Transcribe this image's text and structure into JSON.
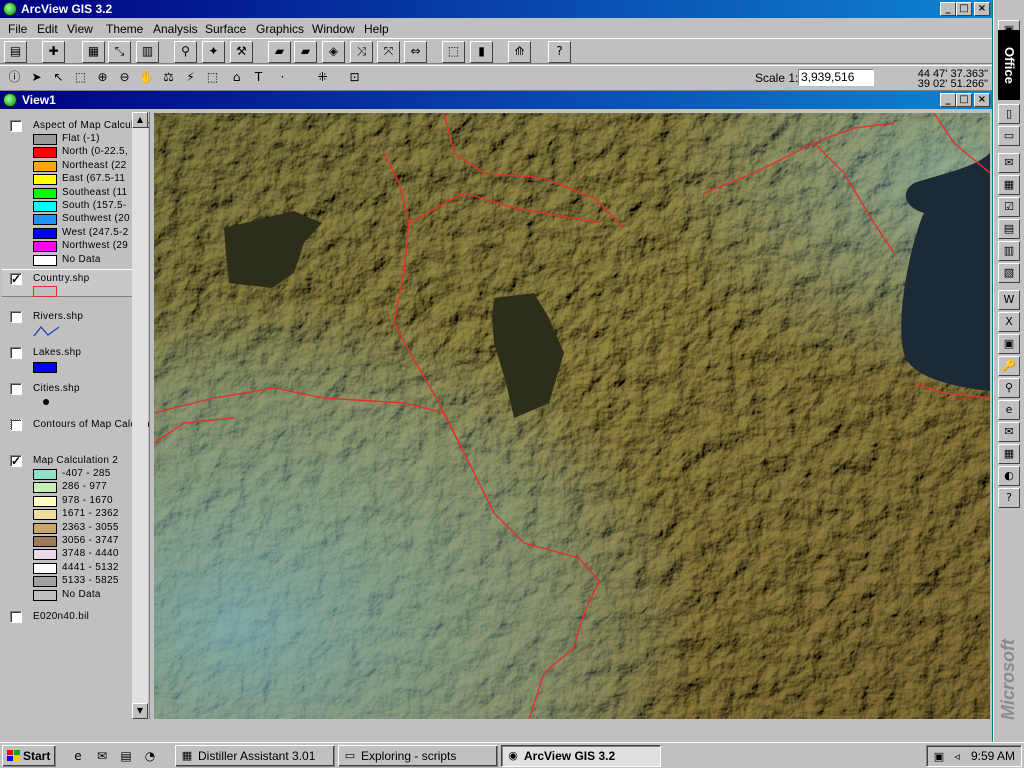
{
  "app": {
    "title": "ArcView GIS 3.2"
  },
  "menu": [
    "File",
    "Edit",
    "View",
    "Theme",
    "Analysis",
    "Surface",
    "Graphics",
    "Window",
    "Help"
  ],
  "toolbar1": {
    "icons": [
      "save-icon",
      "add-theme-icon",
      "theme-properties-icon",
      "edit-legend-icon",
      "open-table-icon",
      "find-icon",
      "locate-address-icon",
      "query-builder-icon",
      "zoom-full-extent-icon",
      "zoom-active-themes-icon",
      "zoom-selected-icon",
      "zoom-in-icon",
      "zoom-out-icon",
      "zoom-previous-icon",
      "select-by-theme-icon",
      "open-theme-table-icon",
      "create-chart-icon",
      "help-icon"
    ]
  },
  "toolbar2": {
    "icons": [
      "identify-icon",
      "pointer-icon",
      "vertex-edit-icon",
      "select-feature-icon",
      "zoom-in-tool-icon",
      "zoom-out-tool-icon",
      "pan-icon",
      "measure-icon",
      "hotlink-icon",
      "area-of-interest-icon",
      "label-icon",
      "text-icon",
      "draw-point-icon",
      "snap-icon",
      "graphics-select-icon"
    ],
    "scale_label": "Scale 1:",
    "scale_value": "3,939,516",
    "coord_x": "44 47' 37.363\"",
    "coord_y": "39 02' 51.266\""
  },
  "view": {
    "title": "View1"
  },
  "toc": {
    "aspect": {
      "name": "Aspect of Map Calculation",
      "checked": false,
      "classes": [
        {
          "label": "Flat (-1)",
          "color": "#9a9a9a"
        },
        {
          "label": "North (0-22.5,",
          "color": "#ff0000"
        },
        {
          "label": "Northeast (22",
          "color": "#ffa500"
        },
        {
          "label": "East (67.5-11",
          "color": "#ffff00"
        },
        {
          "label": "Southeast (11",
          "color": "#00ff00"
        },
        {
          "label": "South (157.5-",
          "color": "#00ffff"
        },
        {
          "label": "Southwest (20",
          "color": "#1e90ff"
        },
        {
          "label": "West (247.5-2",
          "color": "#0000ff"
        },
        {
          "label": "Northwest (29",
          "color": "#ff00ff"
        },
        {
          "label": "No Data",
          "color": "#ffffff"
        }
      ]
    },
    "country": {
      "name": "Country.shp",
      "checked": true,
      "symbol_color": "#e03030"
    },
    "rivers": {
      "name": "Rivers.shp",
      "checked": false,
      "symbol_color": "#2040c0"
    },
    "lakes": {
      "name": "Lakes.shp",
      "checked": false,
      "symbol_color": "#0000ff"
    },
    "cities": {
      "name": "Cities.shp",
      "checked": false
    },
    "contours": {
      "name": "Contours of Map Calculation",
      "checked": false
    },
    "mapcalc": {
      "name": "Map Calculation 2",
      "checked": true,
      "classes": [
        {
          "label": "-407 - 285",
          "color": "#8fe0c8"
        },
        {
          "label": "286 - 977",
          "color": "#c4f0b8"
        },
        {
          "label": "978 - 1670",
          "color": "#ffffc0"
        },
        {
          "label": "1671 - 2362",
          "color": "#f0dc9c"
        },
        {
          "label": "2363 - 3055",
          "color": "#c8a86a"
        },
        {
          "label": "3056 - 3747",
          "color": "#9c7a5a"
        },
        {
          "label": "3748 - 4440",
          "color": "#e8d8e8"
        },
        {
          "label": "4441 - 5132",
          "color": "#ffffff"
        },
        {
          "label": "5133 - 5825",
          "color": "#a0a0a0"
        },
        {
          "label": "No Data",
          "color": "#c0c0c0"
        }
      ]
    },
    "e020": {
      "name": "E020n40.bil",
      "checked": false
    }
  },
  "office_bar": {
    "label": "Office",
    "brand": "Microsoft"
  },
  "taskbar": {
    "start": "Start",
    "tasks": [
      {
        "label": "Distiller Assistant 3.01",
        "active": false
      },
      {
        "label": "Exploring - scripts",
        "active": false
      },
      {
        "label": "ArcView GIS 3.2",
        "active": true
      }
    ],
    "clock": "9:59 AM"
  },
  "colors": {
    "title_bar": "#000080",
    "border_red": "#e03030",
    "water": "#1c2a36",
    "lake": "#2c2e1a"
  }
}
